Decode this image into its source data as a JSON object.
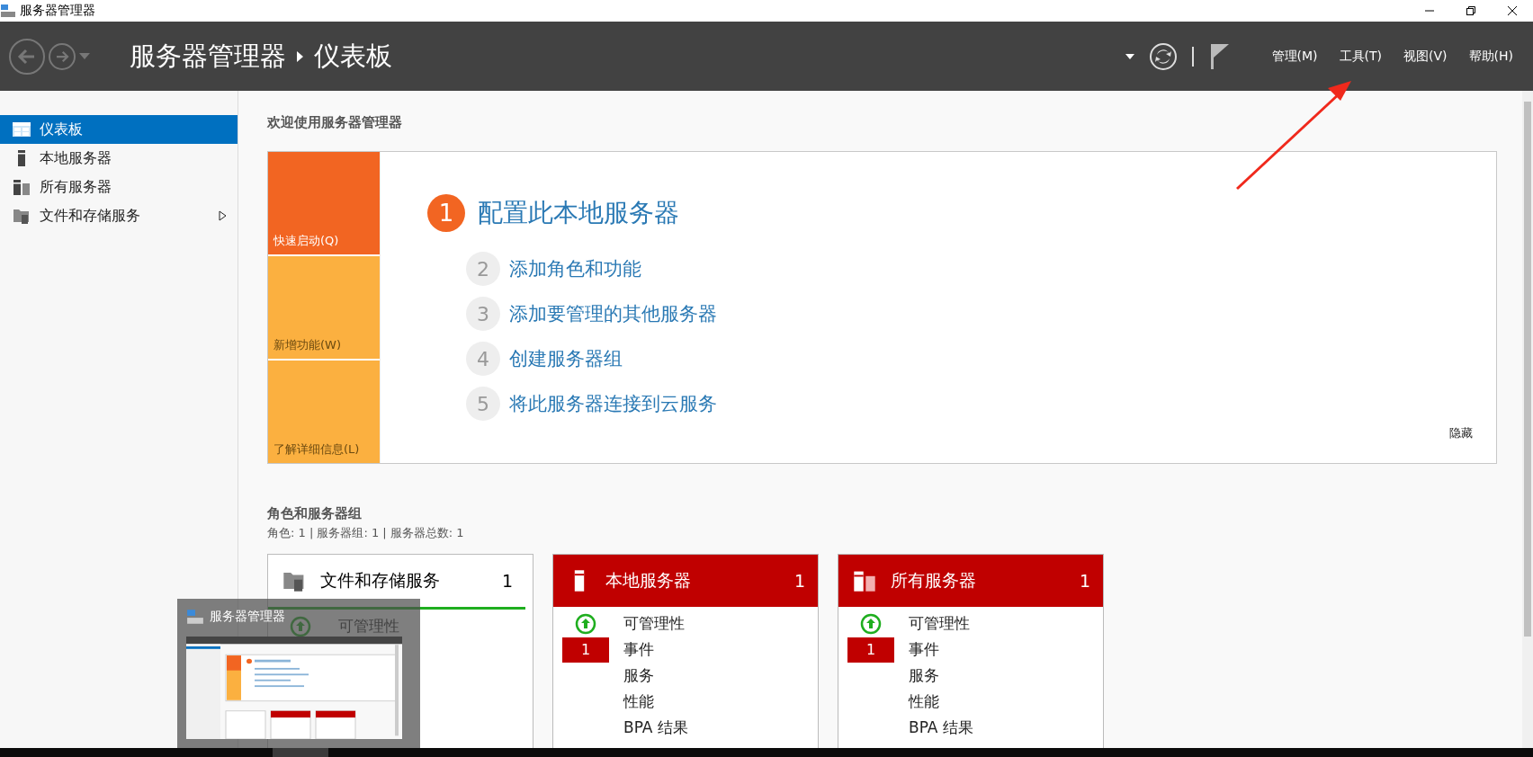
{
  "window": {
    "title": "服务器管理器"
  },
  "header": {
    "breadcrumb": [
      "服务器管理器",
      "仪表板"
    ],
    "menu": [
      "管理(M)",
      "工具(T)",
      "视图(V)",
      "帮助(H)"
    ]
  },
  "sidebar": {
    "items": [
      {
        "label": "仪表板",
        "kind": "dashboard",
        "selected": true,
        "has_children": false
      },
      {
        "label": "本地服务器",
        "kind": "server",
        "selected": false,
        "has_children": false
      },
      {
        "label": "所有服务器",
        "kind": "servers",
        "selected": false,
        "has_children": false
      },
      {
        "label": "文件和存储服务",
        "kind": "storage",
        "selected": false,
        "has_children": true
      }
    ]
  },
  "welcome": {
    "title": "欢迎使用服务器管理器",
    "tabs": [
      {
        "label": "快速启动(Q)",
        "selected": true
      },
      {
        "label": "新增功能(W)",
        "selected": false
      },
      {
        "label": "了解详细信息(L)",
        "selected": false
      }
    ],
    "steps": [
      {
        "number": "1",
        "label": "配置此本地服务器",
        "primary": true
      },
      {
        "number": "2",
        "label": "添加角色和功能",
        "primary": false
      },
      {
        "number": "3",
        "label": "添加要管理的其他服务器",
        "primary": false
      },
      {
        "number": "4",
        "label": "创建服务器组",
        "primary": false
      },
      {
        "number": "5",
        "label": "将此服务器连接到云服务",
        "primary": false
      }
    ],
    "hide": "隐藏"
  },
  "roles": {
    "title": "角色和服务器组",
    "summary": "角色: 1 | 服务器组: 1 | 服务器总数: 1",
    "tiles": [
      {
        "title": "文件和存储服务",
        "count": "1",
        "kind": "storage",
        "alert": false,
        "rows": [
          {
            "label": "可管理性",
            "kind": "ok"
          }
        ]
      },
      {
        "title": "本地服务器",
        "count": "1",
        "kind": "server",
        "alert": true,
        "rows": [
          {
            "label": "可管理性",
            "kind": "ok"
          },
          {
            "label": "事件",
            "kind": "alert",
            "badge": "1"
          },
          {
            "label": "服务",
            "kind": "plain"
          },
          {
            "label": "性能",
            "kind": "plain"
          },
          {
            "label": "BPA 结果",
            "kind": "plain"
          }
        ]
      },
      {
        "title": "所有服务器",
        "count": "1",
        "kind": "servers",
        "alert": true,
        "rows": [
          {
            "label": "可管理性",
            "kind": "ok"
          },
          {
            "label": "事件",
            "kind": "alert",
            "badge": "1"
          },
          {
            "label": "服务",
            "kind": "plain"
          },
          {
            "label": "性能",
            "kind": "plain"
          },
          {
            "label": "BPA 结果",
            "kind": "plain"
          }
        ]
      }
    ]
  },
  "taskbar_preview": {
    "title": "服务器管理器"
  }
}
